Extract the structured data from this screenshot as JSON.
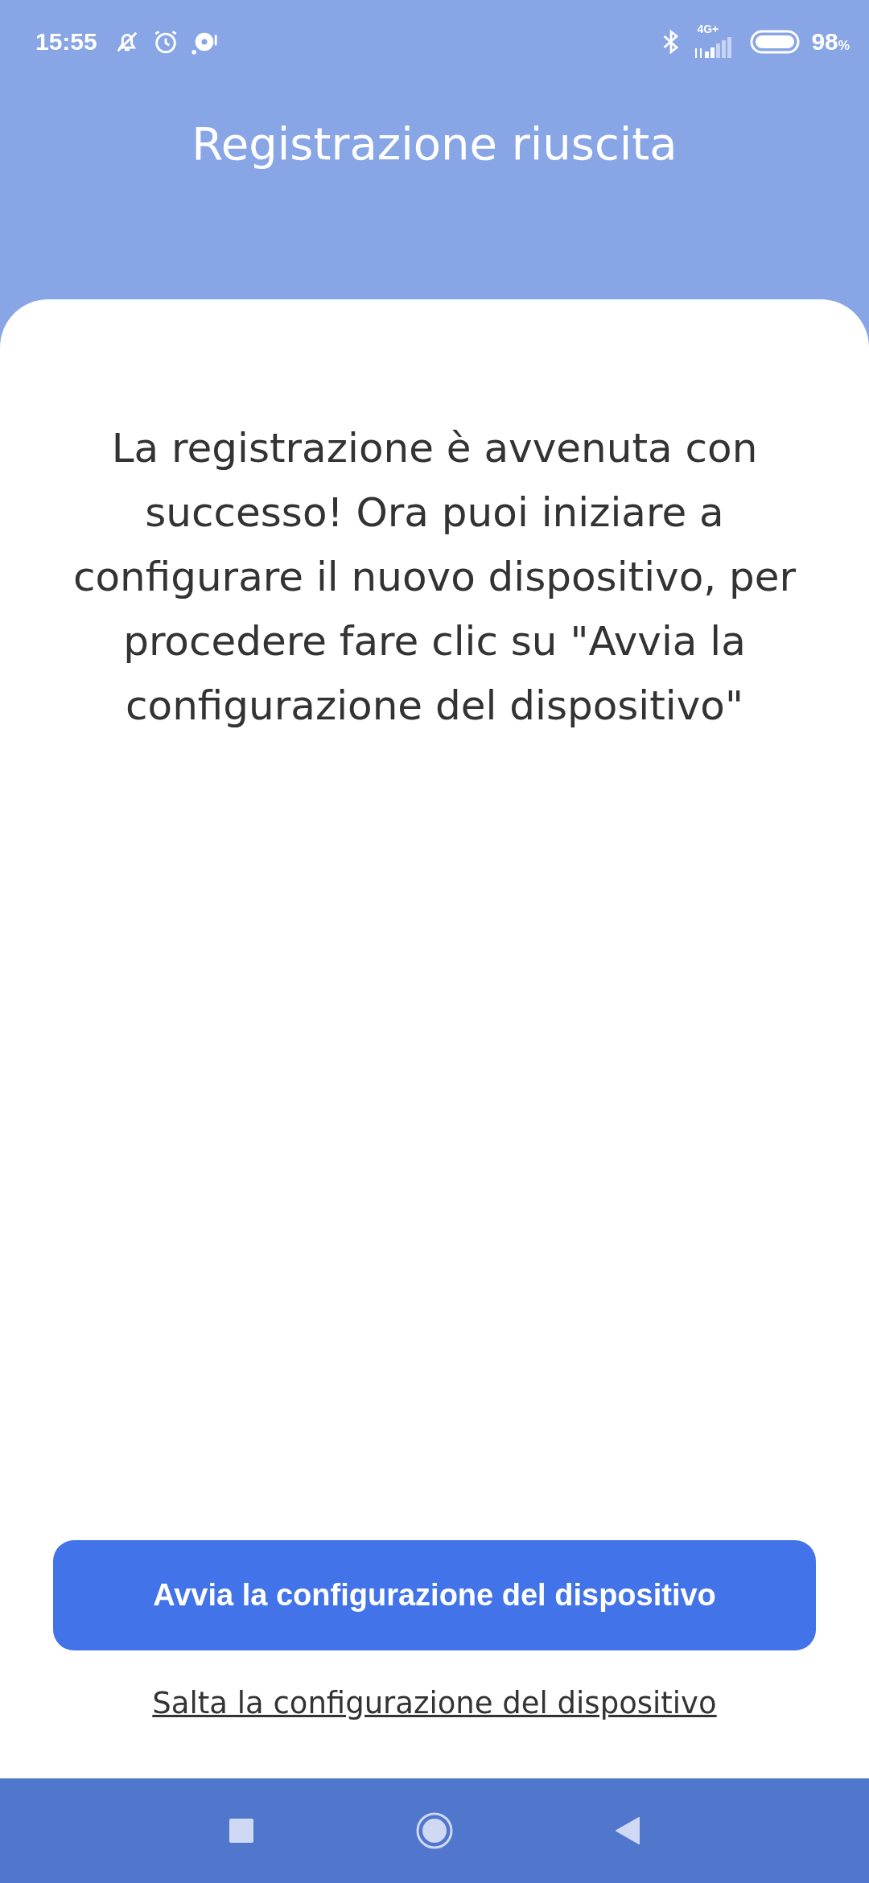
{
  "status_bar": {
    "time": "15:55",
    "network": "4G+",
    "battery": "98",
    "battery_unit": "%"
  },
  "header": {
    "title": "Registrazione riuscita"
  },
  "message": "La registrazione è avvenuta con successo! Ora puoi iniziare a configurare il nuovo dispositivo, per procedere fare clic su \"Avvia la configurazione del dispositivo\"",
  "primary_button": "Avvia la configurazione del dispositivo",
  "skip_link": "Salta la configurazione del dispositivo"
}
